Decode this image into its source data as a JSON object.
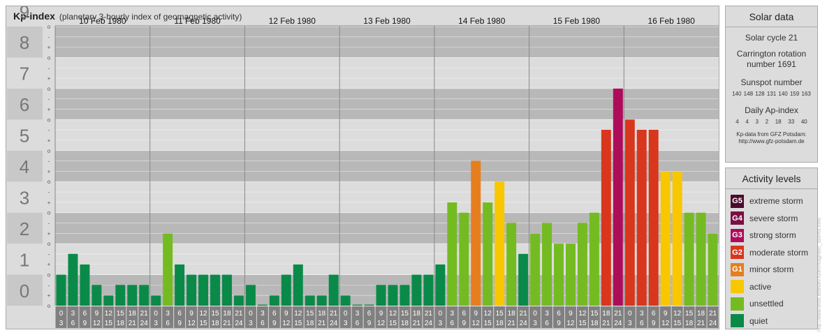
{
  "header": {
    "title": "Kp-index",
    "subtitle": "(planetary 3-hourly index of geomagnetic activity)"
  },
  "solar": {
    "heading": "Solar data",
    "cycle": "Solar cycle 21",
    "carrington": "Carrington rotation number 1691",
    "sunspot_label": "Sunspot number",
    "sunspot_values": "140 148 128 131 140 159 163",
    "ap_label": "Daily Ap-index",
    "ap_values": "4   4   3   2   18   33   40",
    "source": "Kp-data from GFZ Potsdam: http://www.gfz-potsdam.de"
  },
  "activity": {
    "heading": "Activity levels",
    "levels": [
      {
        "code": "G5",
        "label": "extreme storm",
        "color": "#4d0a2d"
      },
      {
        "code": "G4",
        "label": "severe storm",
        "color": "#7a0e45"
      },
      {
        "code": "G3",
        "label": "strong storm",
        "color": "#ad0c5b"
      },
      {
        "code": "G2",
        "label": "moderate storm",
        "color": "#d8361d"
      },
      {
        "code": "G1",
        "label": "minor storm",
        "color": "#e67e1e"
      },
      {
        "code": "",
        "label": "active",
        "color": "#f8c700"
      },
      {
        "code": "",
        "label": "unsettled",
        "color": "#74bb22"
      },
      {
        "code": "",
        "label": "quiet",
        "color": "#0a8a48"
      }
    ]
  },
  "watermark": "http://www.tesis.lebedev.ru/en/magnetic_storms.html",
  "chart_data": {
    "type": "bar",
    "ylim": [
      0,
      9
    ],
    "yticks": [
      "0",
      "1",
      "2",
      "3",
      "4",
      "5",
      "6",
      "7",
      "8",
      "9"
    ],
    "minor_marks": [
      "-",
      "o",
      "+"
    ],
    "days": [
      "10 Feb 1980",
      "11 Feb 1980",
      "12 Feb 1980",
      "13 Feb 1980",
      "14 Feb 1980",
      "15 Feb 1980",
      "16 Feb 1980"
    ],
    "interval_labels": [
      [
        "0",
        "3"
      ],
      [
        "3",
        "6"
      ],
      [
        "6",
        "9"
      ],
      [
        "9",
        "12"
      ],
      [
        "12",
        "15"
      ],
      [
        "15",
        "18"
      ],
      [
        "18",
        "21"
      ],
      [
        "21",
        "24"
      ]
    ],
    "series": [
      {
        "day": "10 Feb 1980",
        "values": [
          1.0,
          1.67,
          1.33,
          0.67,
          0.33,
          0.67,
          0.67,
          0.67
        ]
      },
      {
        "day": "11 Feb 1980",
        "values": [
          0.33,
          2.33,
          1.33,
          1.0,
          1.0,
          1.0,
          1.0,
          0.33
        ]
      },
      {
        "day": "12 Feb 1980",
        "values": [
          0.67,
          0.0,
          0.33,
          1.0,
          1.33,
          0.33,
          0.33,
          1.0
        ]
      },
      {
        "day": "13 Feb 1980",
        "values": [
          0.33,
          0.0,
          0.0,
          0.67,
          0.67,
          0.67,
          1.0,
          1.0
        ]
      },
      {
        "day": "14 Feb 1980",
        "values": [
          1.33,
          3.33,
          3.0,
          4.67,
          3.33,
          4.0,
          2.67,
          1.67
        ]
      },
      {
        "day": "15 Feb 1980",
        "values": [
          2.33,
          2.67,
          2.0,
          2.0,
          2.67,
          3.0,
          5.67,
          7.0
        ]
      },
      {
        "day": "16 Feb 1980",
        "values": [
          6.0,
          5.67,
          5.67,
          4.33,
          4.33,
          3.0,
          3.0,
          2.33
        ]
      }
    ],
    "level_colors": {
      "quiet": "#0a8a48",
      "unsettled": "#74bb22",
      "active": "#f8c700",
      "G1": "#e67e1e",
      "G2": "#d8361d",
      "G3": "#ad0c5b",
      "G4": "#7a0e45",
      "G5": "#4d0a2d"
    }
  }
}
